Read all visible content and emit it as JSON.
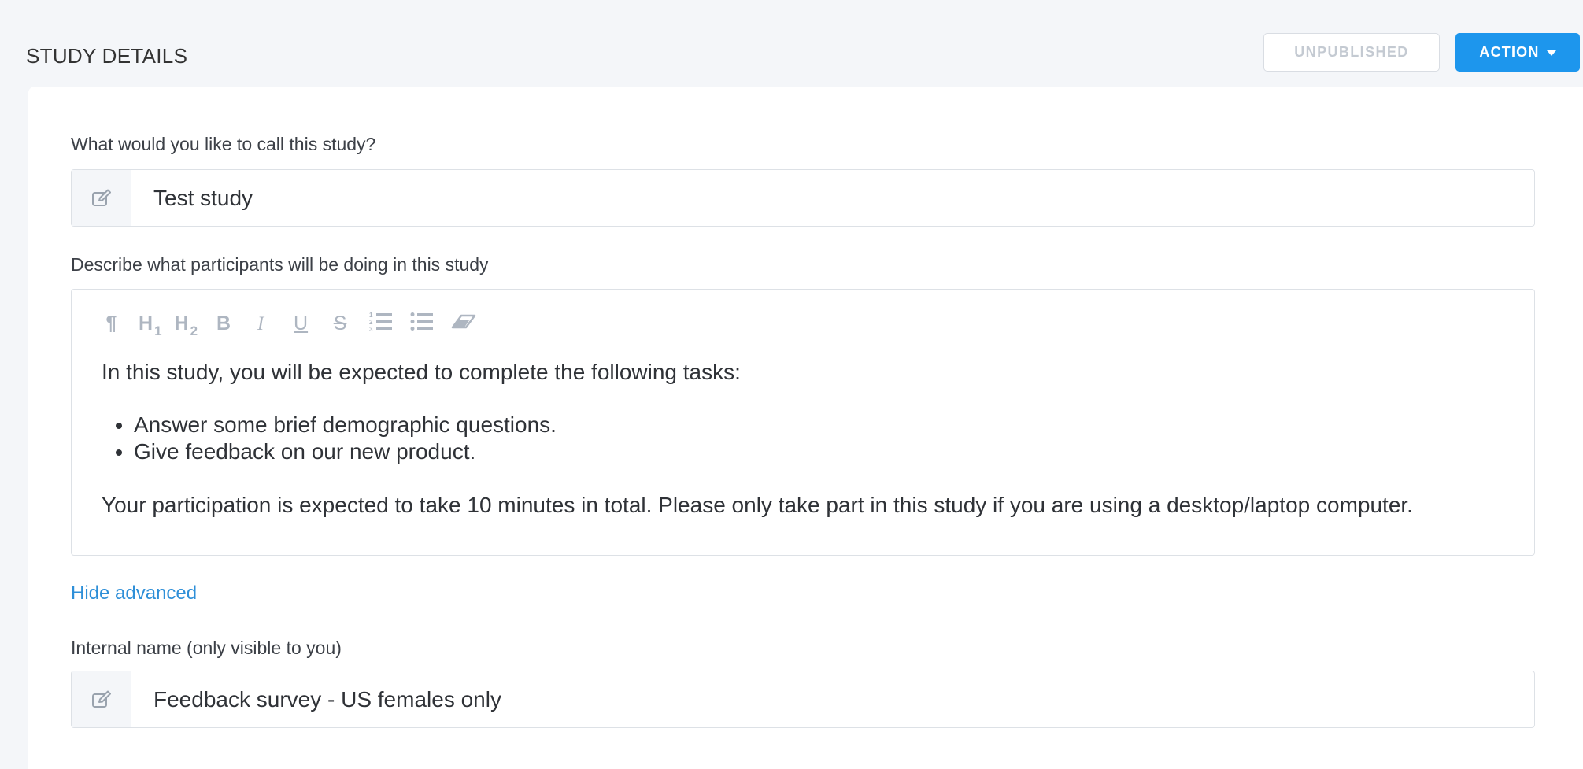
{
  "header": {
    "title": "STUDY DETAILS",
    "status_button": "UNPUBLISHED",
    "action_button": "ACTION"
  },
  "form": {
    "study_name": {
      "label": "What would you like to call this study?",
      "value": "Test study",
      "icon": "edit-icon"
    },
    "description": {
      "label": "Describe what participants will be doing in this study",
      "toolbar": [
        {
          "name": "paragraph",
          "glyph": "¶"
        },
        {
          "name": "heading-1",
          "glyph": "H",
          "sub": "1"
        },
        {
          "name": "heading-2",
          "glyph": "H",
          "sub": "2"
        },
        {
          "name": "bold",
          "glyph": "B"
        },
        {
          "name": "italic",
          "glyph": "I"
        },
        {
          "name": "underline",
          "glyph": "U"
        },
        {
          "name": "strikethrough",
          "glyph": "S"
        },
        {
          "name": "ordered-list",
          "glyph": ""
        },
        {
          "name": "bullet-list",
          "glyph": ""
        },
        {
          "name": "clear-format",
          "glyph": ""
        }
      ],
      "intro": "In this study, you will be expected to complete the following tasks:",
      "tasks": [
        "Answer some brief demographic questions.",
        "Give feedback on our new product."
      ],
      "closing": "Your participation is expected to take 10 minutes in total. Please only take part in this study if you are using a desktop/laptop computer."
    },
    "advanced_toggle": "Hide advanced",
    "internal_name": {
      "label": "Internal name (only visible to you)",
      "value": "Feedback survey - US females only",
      "icon": "edit-icon"
    }
  },
  "colors": {
    "accent": "#1d96ed",
    "link": "#2e8fd8",
    "page_background": "#f4f6f9",
    "toolbar_icons": "#aeb6c1"
  }
}
